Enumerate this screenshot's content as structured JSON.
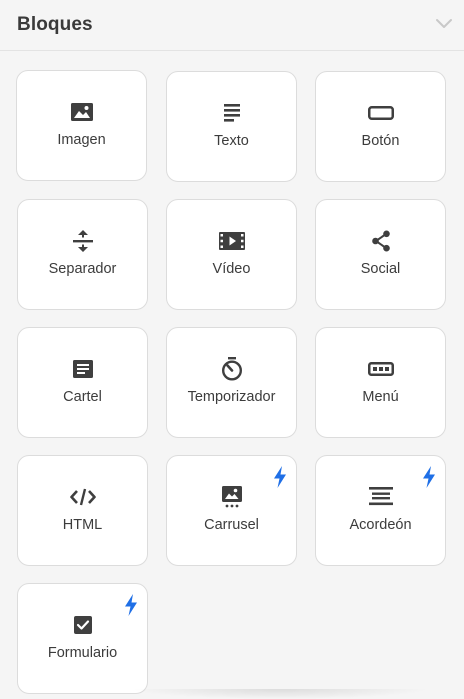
{
  "panel": {
    "title": "Bloques"
  },
  "colors": {
    "selected_border": "#3cc04f",
    "icon": "#3f3f3f",
    "bolt": "#1f6fe6"
  },
  "blocks": [
    {
      "label": "Imagen",
      "icon": "image-icon",
      "selected": true,
      "premium": false
    },
    {
      "label": "Texto",
      "icon": "text-icon",
      "selected": false,
      "premium": false
    },
    {
      "label": "Botón",
      "icon": "button-icon",
      "selected": false,
      "premium": false
    },
    {
      "label": "Separador",
      "icon": "separator-icon",
      "selected": false,
      "premium": false
    },
    {
      "label": "Vídeo",
      "icon": "video-icon",
      "selected": false,
      "premium": false
    },
    {
      "label": "Social",
      "icon": "share-icon",
      "selected": false,
      "premium": false
    },
    {
      "label": "Cartel",
      "icon": "banner-icon",
      "selected": false,
      "premium": false
    },
    {
      "label": "Temporizador",
      "icon": "timer-icon",
      "selected": false,
      "premium": false
    },
    {
      "label": "Menú",
      "icon": "menu-icon",
      "selected": false,
      "premium": false
    },
    {
      "label": "HTML",
      "icon": "code-icon",
      "selected": false,
      "premium": false
    },
    {
      "label": "Carrusel",
      "icon": "carousel-icon",
      "selected": false,
      "premium": true
    },
    {
      "label": "Acordeón",
      "icon": "accordion-icon",
      "selected": false,
      "premium": true
    },
    {
      "label": "Formulario",
      "icon": "checkbox-icon",
      "selected": false,
      "premium": true
    }
  ]
}
